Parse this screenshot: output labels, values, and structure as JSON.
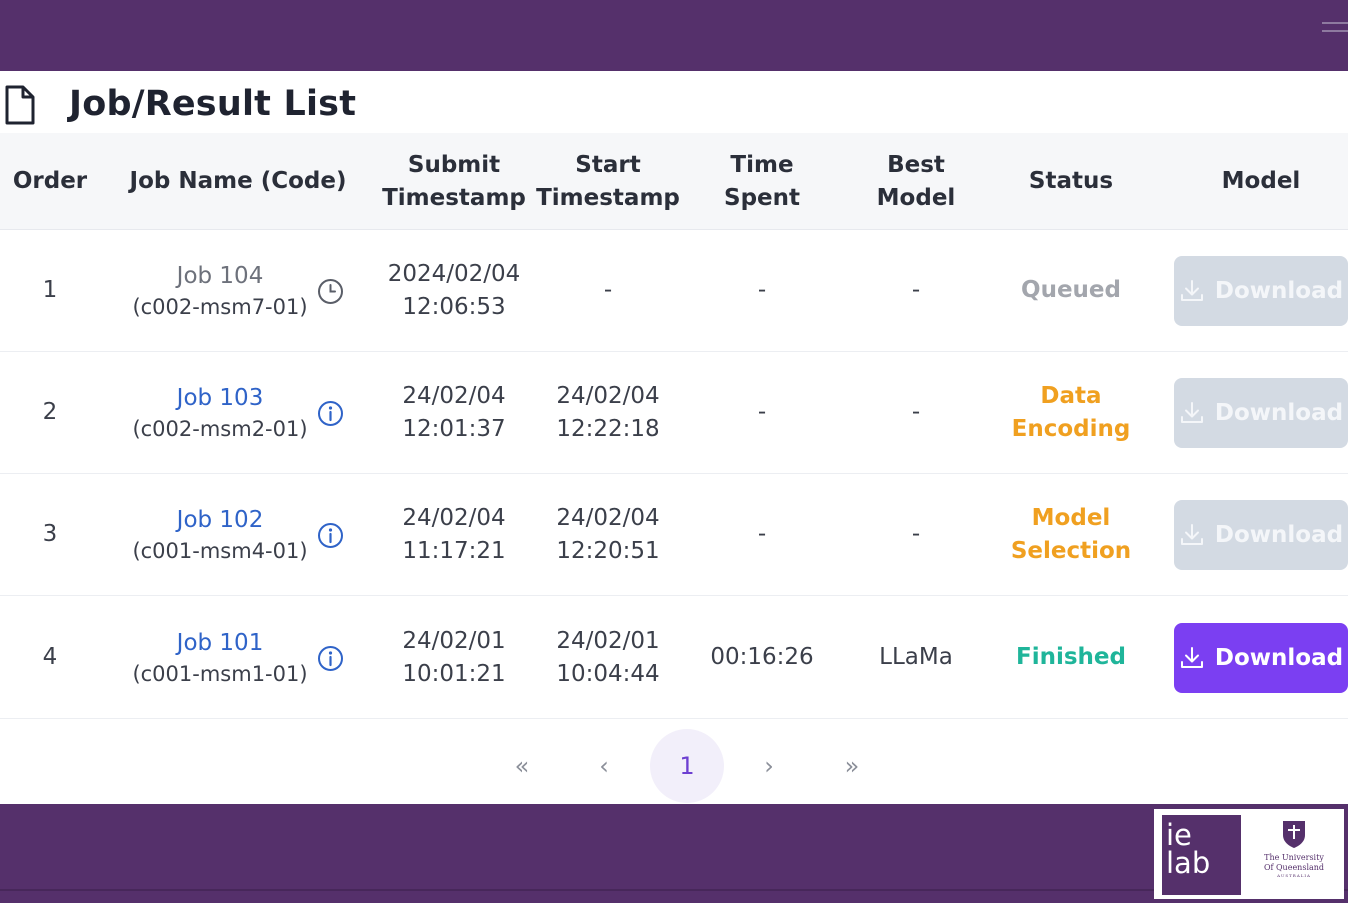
{
  "page": {
    "title": "Job/Result List"
  },
  "table": {
    "headers": {
      "order": "Order",
      "job_name": "Job Name (Code)",
      "submit": "Submit\nTimestamp",
      "start": "Start\nTimestamp",
      "time_spent": "Time\nSpent",
      "best_model": "Best\nModel",
      "status": "Status",
      "model": "Model"
    },
    "rows": [
      {
        "order": "1",
        "job": "Job 104",
        "code": "(c002-msm7-01)",
        "icon": "clock-icon",
        "submit": "2024/02/04\n12:06:53",
        "start": "-",
        "time_spent": "-",
        "best_model": "-",
        "status": "Queued",
        "status_color": "#a3a6ad",
        "download": "Download",
        "download_enabled": false
      },
      {
        "order": "2",
        "job": "Job 103",
        "code": "(c002-msm2-01)",
        "icon": "info-icon",
        "submit": "24/02/04\n12:01:37",
        "start": "24/02/04\n12:22:18",
        "time_spent": "-",
        "best_model": "-",
        "status": "Data\nEncoding",
        "status_color": "#f0a020",
        "download": "Download",
        "download_enabled": false
      },
      {
        "order": "3",
        "job": "Job 102",
        "code": "(c001-msm4-01)",
        "icon": "info-icon",
        "submit": "24/02/04\n11:17:21",
        "start": "24/02/04\n12:20:51",
        "time_spent": "-",
        "best_model": "-",
        "status": "Model\nSelection",
        "status_color": "#f0a020",
        "download": "Download",
        "download_enabled": false
      },
      {
        "order": "4",
        "job": "Job 101",
        "code": "(c001-msm1-01)",
        "icon": "info-icon",
        "submit": "24/02/01\n10:01:21",
        "start": "24/02/01\n10:04:44",
        "time_spent": "00:16:26",
        "best_model": "LLaMa",
        "status": "Finished",
        "status_color": "#1fb59a",
        "download": "Download",
        "download_enabled": true
      }
    ]
  },
  "pagination": {
    "first": "«",
    "prev": "‹",
    "current": "1",
    "next": "›",
    "last": "»"
  },
  "footer": {
    "ielab": "ie\nlab",
    "uq": "The University\nOf Queensland",
    "uq_sub": "AUSTRALIA"
  },
  "colors": {
    "brand": "#55306b",
    "accent": "#7b3ff2",
    "link": "#2f63c8"
  }
}
